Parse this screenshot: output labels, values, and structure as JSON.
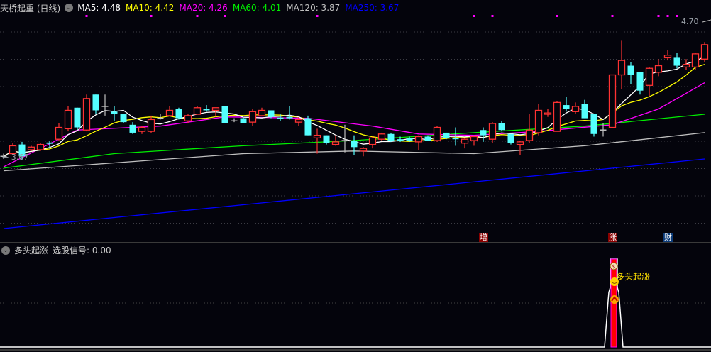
{
  "header": {
    "title": "天桥起重 (日线)",
    "toggle_icon": "chevron-down-circle-icon",
    "ma": [
      {
        "label": "MA5: 4.48",
        "color": "#ffffff"
      },
      {
        "label": "MA10: 4.42",
        "color": "#ffff00"
      },
      {
        "label": "MA20: 4.26",
        "color": "#ff00ff"
      },
      {
        "label": "MA60: 4.01",
        "color": "#00ee00"
      },
      {
        "label": "MA120: 3.87",
        "color": "#c0c0c0"
      },
      {
        "label": "MA250: 3.67",
        "color": "#0000ff"
      }
    ]
  },
  "price_labels": {
    "max": "4.70",
    "min": "← 3.67"
  },
  "markers": [
    {
      "text": "增",
      "index": 52,
      "color": "#8b0000"
    },
    {
      "text": "涨",
      "index": 66,
      "color": "#8b0000"
    },
    {
      "text": "财",
      "index": 72,
      "color": "#0a3a78"
    }
  ],
  "indicator": {
    "title": "多头起涨",
    "value_label": "选股信号: 0.00",
    "signal_text": "多头起涨",
    "icons": [
      "money-bag-icon",
      "smiley-icon",
      "up-arrow-circle-icon"
    ]
  },
  "chart_data": [
    {
      "type": "candlestick",
      "title": "天桥起重 (日线)",
      "colors": {
        "up": "#ff3232",
        "down": "#54ffff",
        "flat": "#c0c0c0"
      },
      "ylim": [
        3.06,
        4.87
      ],
      "grid": true,
      "ohlc": [
        [
          3.68,
          3.7,
          3.66,
          3.68
        ],
        [
          3.7,
          3.78,
          3.69,
          3.76
        ],
        [
          3.77,
          3.79,
          3.65,
          3.68
        ],
        [
          3.73,
          3.76,
          3.72,
          3.75
        ],
        [
          3.73,
          3.78,
          3.72,
          3.77
        ],
        [
          3.785,
          3.8,
          3.74,
          3.775
        ],
        [
          3.81,
          3.93,
          3.8,
          3.9
        ],
        [
          3.89,
          4.06,
          3.87,
          4.03
        ],
        [
          4.05,
          4.05,
          3.88,
          3.9
        ],
        [
          3.88,
          4.15,
          3.87,
          4.12
        ],
        [
          4.15,
          4.15,
          4.0,
          4.03
        ],
        [
          4.06,
          4.15,
          3.99,
          4.06
        ],
        [
          4.02,
          4.06,
          3.95,
          4.0
        ],
        [
          4.0,
          4.0,
          3.93,
          3.94
        ],
        [
          3.92,
          3.94,
          3.85,
          3.86
        ],
        [
          3.87,
          3.91,
          3.85,
          3.9
        ],
        [
          3.87,
          3.99,
          3.86,
          3.96
        ],
        [
          3.97,
          4.0,
          3.96,
          3.97
        ],
        [
          3.99,
          4.06,
          3.99,
          4.03
        ],
        [
          4.04,
          4.05,
          3.96,
          3.97
        ],
        [
          3.95,
          4.0,
          3.93,
          3.99
        ],
        [
          4.0,
          4.06,
          4.0,
          4.05
        ],
        [
          4.04,
          4.07,
          4.02,
          4.03
        ],
        [
          4.03,
          4.05,
          3.98,
          4.05
        ],
        [
          4.06,
          4.06,
          3.93,
          3.93
        ],
        [
          3.95,
          3.97,
          3.94,
          3.95
        ],
        [
          3.97,
          3.98,
          3.93,
          3.93
        ],
        [
          3.94,
          4.04,
          3.91,
          4.02
        ],
        [
          3.99,
          4.05,
          3.99,
          4.03
        ],
        [
          4.03,
          4.03,
          3.97,
          3.98
        ],
        [
          3.975,
          4.0,
          3.95,
          3.965
        ],
        [
          3.98,
          4.06,
          3.96,
          3.97
        ],
        [
          3.94,
          3.98,
          3.91,
          3.96
        ],
        [
          3.97,
          3.99,
          3.84,
          3.84
        ],
        [
          3.82,
          3.89,
          3.7,
          3.84
        ],
        [
          3.84,
          3.84,
          3.77,
          3.78
        ],
        [
          3.77,
          3.84,
          3.76,
          3.79
        ],
        [
          3.8,
          3.92,
          3.71,
          3.8
        ],
        [
          3.8,
          3.84,
          3.69,
          3.75
        ],
        [
          3.72,
          3.75,
          3.68,
          3.74
        ],
        [
          3.77,
          3.83,
          3.74,
          3.82
        ],
        [
          3.81,
          3.86,
          3.8,
          3.85
        ],
        [
          3.85,
          3.86,
          3.79,
          3.8
        ],
        [
          3.81,
          3.83,
          3.79,
          3.8
        ],
        [
          3.82,
          3.83,
          3.79,
          3.8
        ],
        [
          3.79,
          3.84,
          3.73,
          3.83
        ],
        [
          3.83,
          3.84,
          3.8,
          3.8
        ],
        [
          3.8,
          3.91,
          3.79,
          3.9
        ],
        [
          3.86,
          3.86,
          3.81,
          3.82
        ],
        [
          3.82,
          3.9,
          3.76,
          3.81
        ],
        [
          3.78,
          3.82,
          3.74,
          3.81
        ],
        [
          3.8,
          3.84,
          3.76,
          3.83
        ],
        [
          3.88,
          3.9,
          3.79,
          3.84
        ],
        [
          3.81,
          3.94,
          3.78,
          3.93
        ],
        [
          3.93,
          3.95,
          3.87,
          3.88
        ],
        [
          3.85,
          3.85,
          3.77,
          3.78
        ],
        [
          3.77,
          3.8,
          3.69,
          3.79
        ],
        [
          3.8,
          4.0,
          3.78,
          3.88
        ],
        [
          3.86,
          4.08,
          3.84,
          4.03
        ],
        [
          4.0,
          4.04,
          3.98,
          4.01
        ],
        [
          3.87,
          4.1,
          3.87,
          4.09
        ],
        [
          4.07,
          4.13,
          4.02,
          4.04
        ],
        [
          4.02,
          4.09,
          4.0,
          4.06
        ],
        [
          4.08,
          4.11,
          3.97,
          3.97
        ],
        [
          4.0,
          4.0,
          3.83,
          3.85
        ],
        [
          3.88,
          3.93,
          3.83,
          3.88
        ],
        [
          3.9,
          4.3,
          3.9,
          4.3
        ],
        [
          4.3,
          4.56,
          4.19,
          4.41
        ],
        [
          4.37,
          4.4,
          4.23,
          4.3
        ],
        [
          4.32,
          4.32,
          4.15,
          4.18
        ],
        [
          4.22,
          4.36,
          4.14,
          4.35
        ],
        [
          4.32,
          4.42,
          4.29,
          4.37
        ],
        [
          4.43,
          4.49,
          4.41,
          4.45
        ],
        [
          4.43,
          4.47,
          4.35,
          4.37
        ],
        [
          4.36,
          4.42,
          4.34,
          4.38
        ],
        [
          4.36,
          4.47,
          4.34,
          4.46
        ],
        [
          4.42,
          4.55,
          4.4,
          4.53
        ]
      ],
      "ma_series": [
        {
          "name": "MA5",
          "period": 5,
          "color": "#ffffff"
        },
        {
          "name": "MA10",
          "period": 10,
          "color": "#ffff00"
        },
        {
          "name": "MA20",
          "color": "#ff00ff",
          "points": [
            [
              0,
              3.6
            ],
            [
              8,
              3.88
            ],
            [
              17,
              3.91
            ],
            [
              24,
              3.98
            ],
            [
              33,
              3.97
            ],
            [
              40,
              3.91
            ],
            [
              45,
              3.85
            ],
            [
              51,
              3.84
            ],
            [
              58,
              3.87
            ],
            [
              66,
              3.92
            ],
            [
              71,
              4.04
            ],
            [
              76,
              4.24
            ]
          ]
        },
        {
          "name": "MA60",
          "color": "#00ee00",
          "points": [
            [
              0,
              3.59
            ],
            [
              12,
              3.7
            ],
            [
              26,
              3.76
            ],
            [
              38,
              3.8
            ],
            [
              51,
              3.86
            ],
            [
              63,
              3.91
            ],
            [
              76,
              4.0
            ]
          ]
        },
        {
          "name": "MA120",
          "color": "#c0c0c0",
          "points": [
            [
              0,
              3.57
            ],
            [
              12,
              3.63
            ],
            [
              26,
              3.7
            ],
            [
              38,
              3.72
            ],
            [
              51,
              3.7
            ],
            [
              63,
              3.76
            ],
            [
              76,
              3.86
            ]
          ]
        },
        {
          "name": "MA250",
          "color": "#0000ff",
          "points": [
            [
              0,
              3.13
            ],
            [
              76,
              3.66
            ]
          ]
        }
      ],
      "top_dots": [
        9,
        16,
        21,
        24,
        34,
        51,
        53,
        60,
        66,
        71,
        72,
        73
      ],
      "top_dot_color": "#ff00ff"
    },
    {
      "type": "line",
      "title": "多头起涨",
      "series": [
        {
          "name": "选股信号",
          "signal_index": 66,
          "last_value": 0.0
        }
      ]
    }
  ]
}
